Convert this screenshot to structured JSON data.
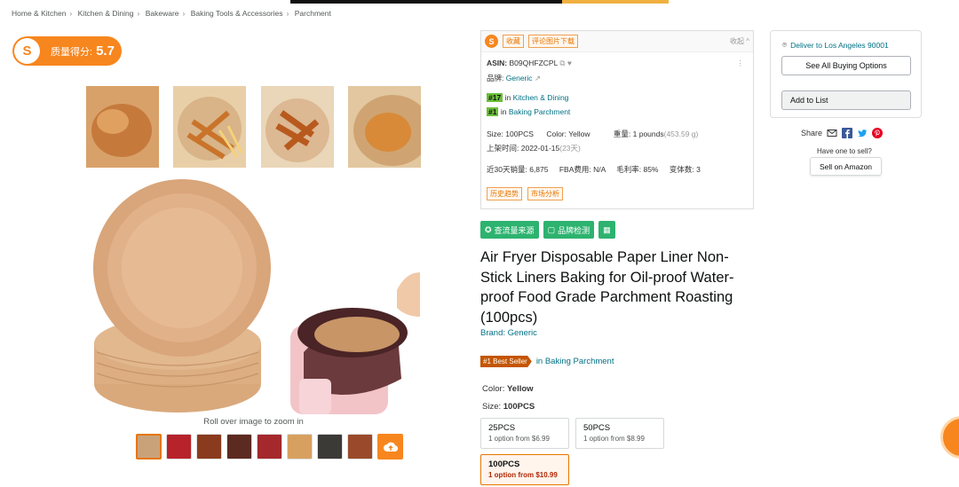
{
  "breadcrumb": [
    "Home & Kitchen",
    "Kitchen & Dining",
    "Bakeware",
    "Baking Tools & Accessories",
    "Parchment"
  ],
  "quality_score": {
    "label": "质量得分:",
    "value": "5.7"
  },
  "gallery": {
    "zoom_hint": "Roll over image to zoom in"
  },
  "plugin": {
    "tags": [
      "收藏",
      "评论图片下载"
    ],
    "collapse": "收起 ^",
    "asin_label": "ASIN:",
    "asin": "B09QHFZCPL",
    "brand_label": "品牌:",
    "brand": "Generic",
    "rank1": "#17",
    "rank1_in": "in",
    "rank1_cat": "Kitchen & Dining",
    "rank2": "#1",
    "rank2_in": "in",
    "rank2_cat": "Baking Parchment",
    "size_label": "Size:",
    "size": "100PCS",
    "color_label": "Color:",
    "color": "Yellow",
    "weight_label": "重量:",
    "weight": "1 pounds",
    "weight_g": "(453.59 g)",
    "listed_label": "上架时间:",
    "listed": "2022-01-15",
    "listed_days": "(23天)",
    "sales_label": "近30天销量:",
    "sales": "6,875",
    "fba_label": "FBA费用:",
    "fba": "N/A",
    "margin_label": "毛利率:",
    "margin": "85%",
    "variants_label": "变体数:",
    "variants": "3",
    "btn_history": "历史趋势",
    "btn_market": "市场分析"
  },
  "actions": {
    "traffic": "查流量来源",
    "brand_check": "品牌检测"
  },
  "product": {
    "title": "Air Fryer Disposable Paper Liner Non-Stick Liners Baking for Oil-proof Water-proof Food Grade Parchment Roasting (100pcs)",
    "brand_link": "Brand: Generic",
    "best_seller": "#1 Best Seller",
    "best_seller_in": "in Baking Parchment",
    "color_label": "Color:",
    "color_value": "Yellow",
    "size_label": "Size:",
    "size_value": "100PCS",
    "options": [
      {
        "name": "25PCS",
        "price": "1 option from $6.99"
      },
      {
        "name": "50PCS",
        "price": "1 option from $8.99"
      },
      {
        "name": "100PCS",
        "price": "1 option from $10.99"
      }
    ]
  },
  "buybox": {
    "deliver": "Deliver to Los Angeles 90001",
    "see_all": "See All Buying Options",
    "add_list": "Add to List",
    "share": "Share",
    "have_one": "Have one to sell?",
    "sell": "Sell on Amazon"
  },
  "colors": {
    "accent": "#f7861e",
    "link": "#007185",
    "green": "#2db36f",
    "bestseller": "#c45500",
    "price": "#b12704"
  }
}
